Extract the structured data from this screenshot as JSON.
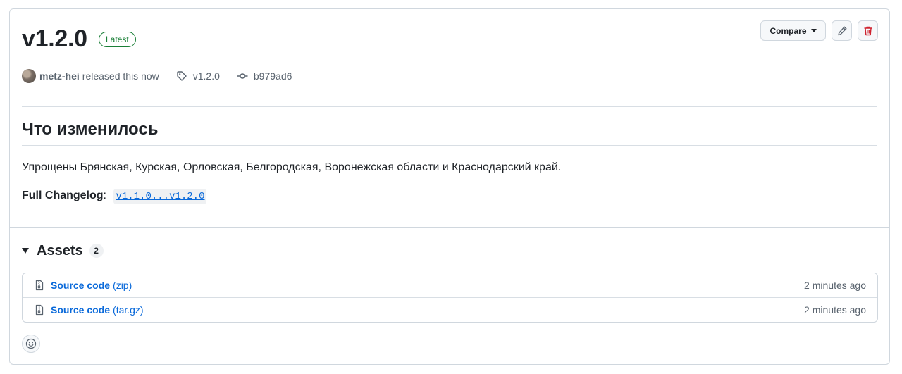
{
  "release": {
    "title": "v1.2.0",
    "badge": "Latest",
    "author": "metz-hei",
    "released_text": "released this now",
    "tag": "v1.2.0",
    "commit": "b979ad6"
  },
  "actions": {
    "compare_label": "Compare"
  },
  "notes": {
    "heading": "Что изменилось",
    "body": "Упрощены Брянская, Курская, Орловская, Белгородская, Воронежская области и Краснодарский край.",
    "changelog_label": "Full Changelog",
    "changelog_colon": ":",
    "changelog_link": "v1.1.0...v1.2.0"
  },
  "assets": {
    "title": "Assets",
    "count": "2",
    "items": [
      {
        "name": "Source code",
        "ext": "(zip)",
        "time": "2 minutes ago"
      },
      {
        "name": "Source code",
        "ext": "(tar.gz)",
        "time": "2 minutes ago"
      }
    ]
  },
  "colors": {
    "latest_green": "#1a7f37",
    "link_blue": "#0969da",
    "delete_red": "#cf222e",
    "border": "#d0d7de"
  },
  "icons": {
    "tag": "tag-icon",
    "commit": "git-commit-icon",
    "edit": "pencil-icon",
    "delete": "trash-icon",
    "zip": "file-zip-icon",
    "reaction": "smiley-icon"
  }
}
